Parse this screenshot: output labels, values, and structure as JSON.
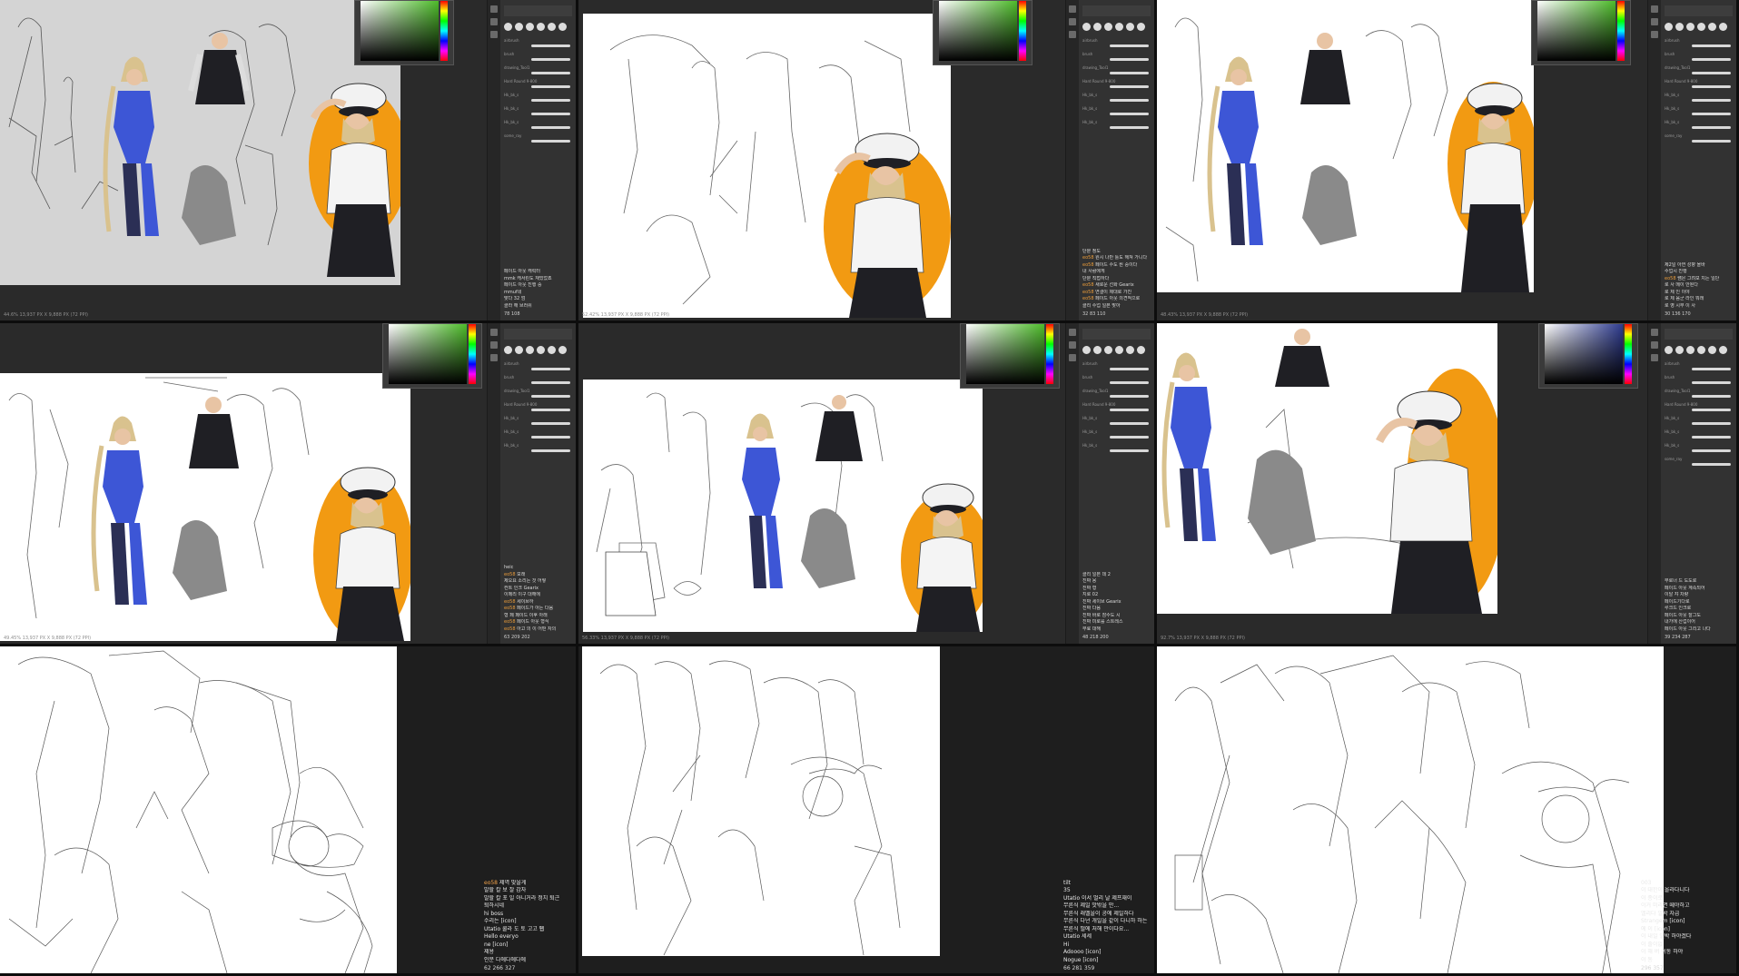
{
  "panels": [
    {
      "status": "44.6% 13,937 PX X 9,888 PX (72 PPI)",
      "chat": [
        {
          "user": "",
          "text": "페이드 아웃 캐릭터"
        },
        {
          "user": "",
          "text": "mmk 캐서린도 재밌었죠"
        },
        {
          "user": "",
          "text": "페이드 아웃 진행 중"
        },
        {
          "user": "",
          "text": "mmuf네"
        },
        {
          "user": "",
          "text": "맞다 32 엄"
        },
        {
          "user": "",
          "text": "클라 해 브러쉬"
        }
      ],
      "footer": "78 108"
    },
    {
      "status": "52.42% 13,937 PX X 9,888 PX (72 PPI)",
      "chat": [
        {
          "user": "",
          "text": "단분 정도"
        },
        {
          "user": "eo58",
          "text": "원시 나만 틀도 해져 가니다"
        },
        {
          "user": "eo58",
          "text": "페이드 수도 뭔 중이다"
        },
        {
          "user": "",
          "text": "내 사람에게"
        },
        {
          "user": "",
          "text": "단분 직접하다"
        },
        {
          "user": "eo58",
          "text": "새로운 선화 Gearix"
        },
        {
          "user": "eo58",
          "text": "연결이 제대로 가진"
        },
        {
          "user": "eo58",
          "text": "페이드 아웃 의견적으로"
        },
        {
          "user": "",
          "text": "클리 수업 일본 맞아"
        }
      ],
      "footer": "32 83 110"
    },
    {
      "status": "48.43% 13,937 PX X 9,888 PX (72 PPI)",
      "chat": [
        {
          "user": "",
          "text": "제2일 아연 성향 올바"
        },
        {
          "user": "",
          "text": "수업시 진행"
        },
        {
          "user": "eo58",
          "text": "쌤은 그려보 치는 일단"
        },
        {
          "user": "",
          "text": "로 사 메이 안된다"
        },
        {
          "user": "",
          "text": "로 제 인 이야"
        },
        {
          "user": "",
          "text": "로 제 음군 라인 뭐래"
        },
        {
          "user": "",
          "text": "로 영 시무 이 사"
        }
      ],
      "footer": "30 136 170"
    },
    {
      "status": "49.45% 13,937 PX X 9,888 PX (72 PPI)",
      "chat": [
        {
          "user": "",
          "text": "heic"
        },
        {
          "user": "eo58",
          "text": "모래"
        },
        {
          "user": "",
          "text": "제오요 소리는 것 어떻"
        },
        {
          "user": "",
          "text": "컨트 인크 Gearix"
        },
        {
          "user": "",
          "text": "이메리 이구 대해에"
        },
        {
          "user": "eo58",
          "text": "세이브하"
        },
        {
          "user": "eo58",
          "text": "페이드가 아는 다음"
        },
        {
          "user": "",
          "text": "형 페 페이드 이후 아래"
        },
        {
          "user": "eo58",
          "text": "페이드 아웃 형식"
        },
        {
          "user": "eo58",
          "text": "아고 의 이 어떤 자의"
        }
      ],
      "footer": "63 209 202"
    },
    {
      "status": "56.33% 13,937 PX X 9,888 PX (72 PPI)",
      "chat": [
        {
          "user": "",
          "text": "클리 일본 데 2"
        },
        {
          "user": "",
          "text": "진짜 용"
        },
        {
          "user": "",
          "text": "진짜 형"
        },
        {
          "user": "",
          "text": "지로 02"
        },
        {
          "user": "",
          "text": "진짜 세이브 Gearix"
        },
        {
          "user": "",
          "text": "진짜 다음"
        },
        {
          "user": "",
          "text": "진짜 바로 잠수도 시"
        },
        {
          "user": "",
          "text": "진짜 미로를 스트레스"
        },
        {
          "user": "",
          "text": "무료 대해"
        }
      ],
      "footer": "48 218 200"
    },
    {
      "status": "92.7% 13,937 PX X 9,888 PX (72 PPI)",
      "chat": [
        {
          "user": "",
          "text": "무로너 드 도도로"
        },
        {
          "user": "",
          "text": "페이드 아웃 계속되어"
        },
        {
          "user": "",
          "text": "이탈 쟈 차량"
        },
        {
          "user": "",
          "text": "페이드기다로"
        },
        {
          "user": "",
          "text": "루크드 인크로"
        },
        {
          "user": "",
          "text": "페이드 아웃 잘그도"
        },
        {
          "user": "",
          "text": "내가에 산겁이어"
        },
        {
          "user": "",
          "text": "페이드 아웃 그리고 나다"
        }
      ],
      "footer": "39 234 287"
    }
  ],
  "overlay_chats": [
    {
      "lines": [
        {
          "user": "eo58",
          "text": "제역 맞을게"
        },
        {
          "user": "",
          "text": "말할 칼 보 잘 감자"
        },
        {
          "user": "",
          "text": "말할 칼 포 일 아니거라 정치 퇴근"
        },
        {
          "user": "",
          "text": "퇴하시네"
        },
        {
          "user": "",
          "text": "hi boss"
        },
        {
          "user": "",
          "text": "수리는 [icon]"
        },
        {
          "user": "",
          "text": "Utatio 쿨라 도 토 고고 퉵"
        },
        {
          "user": "",
          "text": "Hello everyo"
        },
        {
          "user": "",
          "text": "ne [icon]"
        },
        {
          "user": "",
          "text": "제용"
        },
        {
          "user": "",
          "text": "인분 다에다에다에"
        }
      ],
      "footer": "62 266 327"
    },
    {
      "lines": [
        {
          "user": "",
          "text": "tilt"
        },
        {
          "user": "",
          "text": "35"
        },
        {
          "user": "",
          "text": "Utatio 이서 멀리 날 제프재이"
        },
        {
          "user": "",
          "text": "무른식 제일 맛밖을 만..."
        },
        {
          "user": "",
          "text": "무른식 래벨을이 공에 제일하다"
        },
        {
          "user": "",
          "text": "무른식 다넌 개일을 같이 다니하 하는"
        },
        {
          "user": "",
          "text": "무른식 떨에 처해 만이다요..."
        },
        {
          "user": "",
          "text": "Utatio 세세"
        },
        {
          "user": "",
          "text": "Hi"
        },
        {
          "user": "",
          "text": "Adoooo [icon]"
        },
        {
          "user": "",
          "text": "Nogue [icon]"
        }
      ],
      "footer": "66 281 359"
    },
    {
      "lines": [
        {
          "user": "",
          "text": "003"
        },
        {
          "user": "",
          "text": "이 대한이 올라다니다"
        },
        {
          "user": "",
          "text": "이 종이로"
        },
        {
          "user": "",
          "text": "이거 미리면 떼야하고"
        },
        {
          "user": "",
          "text": "엘리다 일박 자급"
        },
        {
          "user": "",
          "text": "Strangem [icon]"
        },
        {
          "user": "",
          "text": "에 이 [icon]"
        },
        {
          "user": "",
          "text": "이 내일 일박 하야겠다"
        },
        {
          "user": "",
          "text": "이 줄이없"
        },
        {
          "user": "",
          "text": "이 해 버 이동 하야"
        },
        {
          "user": "",
          "text": "이 동"
        }
      ],
      "footer": "296 357"
    }
  ],
  "brush_names": [
    "airbrush",
    "brush",
    "drawing_Tool1",
    "Hard Round 9-800",
    "Hk_bk_s",
    "Hk_bk_s",
    "Hk_bk_s",
    "some_ray",
    "some_ray"
  ],
  "colors": {
    "orange": "#f29a12",
    "blue": "#3d56d6",
    "navy": "#2b2f55",
    "skin": "#e8c4a4",
    "hair": "#d9c28e",
    "black": "#1f1f24",
    "green_picker": "#4dbb2a",
    "blue_picker": "#2e3b8f"
  },
  "icons": [
    "paintbrush-icon",
    "eraser-icon",
    "color-picker-icon",
    "chat-emote-icon"
  ]
}
